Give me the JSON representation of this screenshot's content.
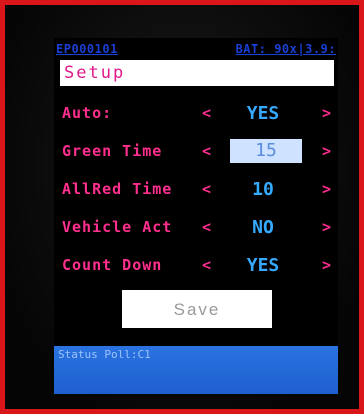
{
  "header": {
    "device_id": "EP000101",
    "battery": "BAT: 90x|3.9:"
  },
  "title": "Setup",
  "settings": [
    {
      "label": "Auto:",
      "left": "<",
      "value": "YES",
      "right": ">"
    },
    {
      "label": "Green Time",
      "left": "<",
      "value": "15",
      "right": ">"
    },
    {
      "label": "AllRed Time",
      "left": "<",
      "value": "10",
      "right": ">"
    },
    {
      "label": "Vehicle Act",
      "left": "<",
      "value": "NO",
      "right": ">"
    },
    {
      "label": "Count Down",
      "left": "<",
      "value": "YES",
      "right": ">"
    }
  ],
  "save_label": "Save",
  "status_text": "Status Poll:C1",
  "colors": {
    "frame": "#d9171b",
    "label": "#ff2f8e",
    "value": "#36aaff",
    "status_bar": "#2a73e0"
  }
}
